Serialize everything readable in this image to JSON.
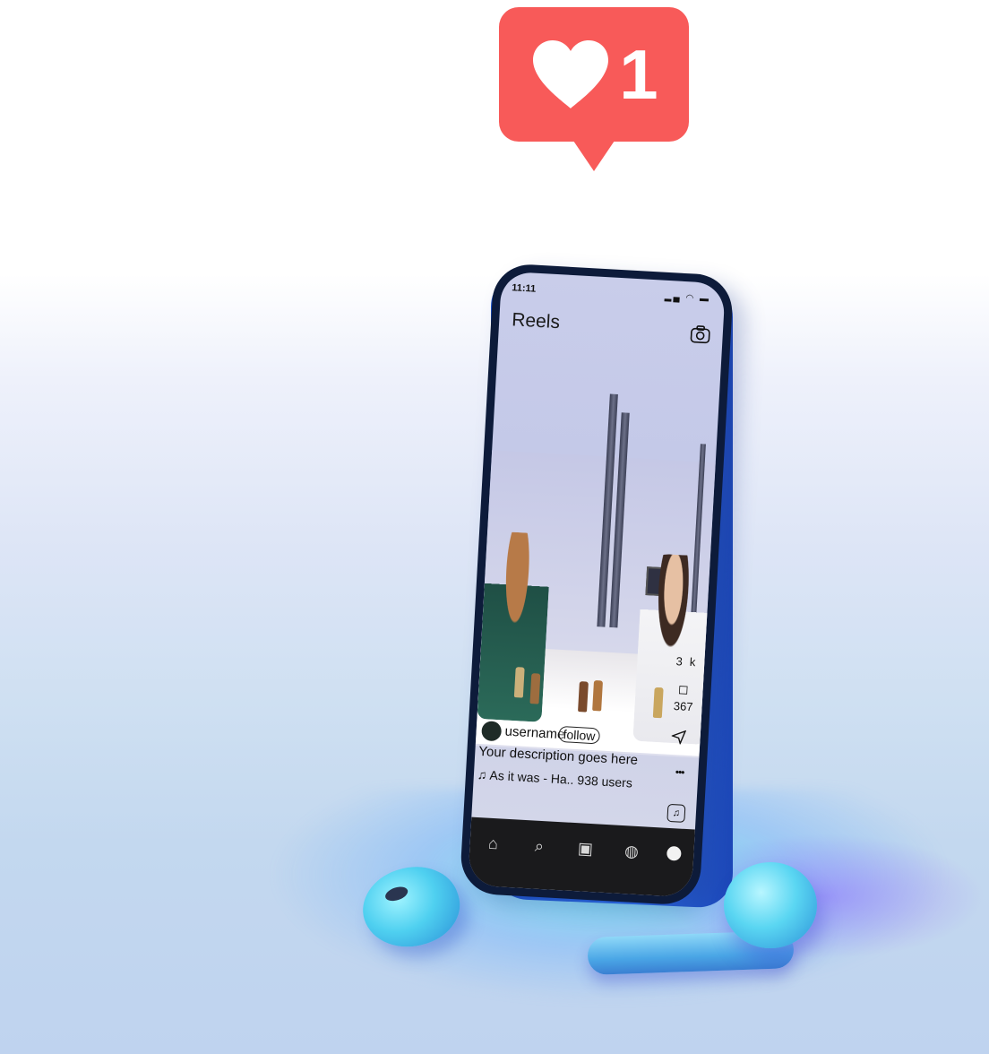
{
  "notification": {
    "icon": "heart-icon",
    "count": "1",
    "color": "#f85a59"
  },
  "status_bar": {
    "time": "11:11",
    "icons": [
      "signal-icon",
      "wifi-icon",
      "battery-icon"
    ]
  },
  "header": {
    "title": "Reels",
    "camera_icon": "camera-icon"
  },
  "actions": {
    "likes_count": "3",
    "likes_suffix": "k",
    "comments_count": "367",
    "share_icon": "send-icon",
    "more_icon": "more-icon",
    "more_glyph": "•••",
    "music_icon": "music-note-icon",
    "music_glyph": "♫"
  },
  "post": {
    "username": "username",
    "follow_label": "follow",
    "description": "Your description goes here",
    "music_glyph": "♫",
    "music_text": "As it was - Ha..",
    "audience": "938 users"
  },
  "bottom_nav": {
    "items": [
      {
        "name": "home-icon",
        "glyph": "⌂"
      },
      {
        "name": "search-icon",
        "glyph": "⌕"
      },
      {
        "name": "reels-icon",
        "glyph": "▣"
      },
      {
        "name": "shop-icon",
        "glyph": "◍"
      },
      {
        "name": "profile-avatar",
        "glyph": ""
      }
    ]
  }
}
